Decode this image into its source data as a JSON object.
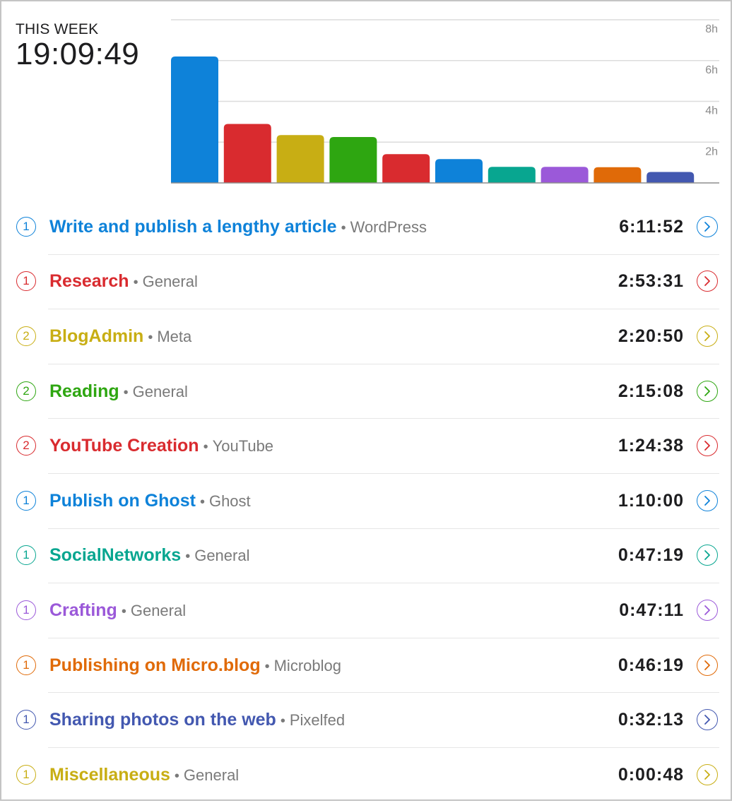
{
  "summary": {
    "label": "THIS WEEK",
    "total": "19:09:49"
  },
  "chart_data": {
    "type": "bar",
    "title": "",
    "xlabel": "",
    "ylabel": "",
    "ylim": [
      0,
      8
    ],
    "yticks": [
      {
        "value": 2,
        "label": "2h"
      },
      {
        "value": 4,
        "label": "4h"
      },
      {
        "value": 6,
        "label": "6h"
      },
      {
        "value": 8,
        "label": "8h"
      }
    ],
    "grid": true,
    "categories": [
      "Write and publish a lengthy article",
      "Research",
      "BlogAdmin",
      "Reading",
      "YouTube Creation",
      "Publish on Ghost",
      "SocialNetworks",
      "Crafting",
      "Publishing on Micro.blog",
      "Sharing photos on the web"
    ],
    "values": [
      6.198,
      2.892,
      2.347,
      2.252,
      1.411,
      1.167,
      0.789,
      0.786,
      0.772,
      0.537
    ],
    "colors": [
      "#0e82d9",
      "#d92b2f",
      "#c8ae14",
      "#2ea611",
      "#d92b2f",
      "#0e82d9",
      "#08a690",
      "#9b59d9",
      "#e06a08",
      "#4358b0"
    ]
  },
  "activities": [
    {
      "count": "1",
      "title": "Write and publish a lengthy article",
      "group": "WordPress",
      "duration": "6:11:52",
      "color": "#0e82d9"
    },
    {
      "count": "1",
      "title": "Research",
      "group": "General",
      "duration": "2:53:31",
      "color": "#d92b2f"
    },
    {
      "count": "2",
      "title": "BlogAdmin",
      "group": "Meta",
      "duration": "2:20:50",
      "color": "#c8ae14"
    },
    {
      "count": "2",
      "title": "Reading",
      "group": "General",
      "duration": "2:15:08",
      "color": "#2ea611"
    },
    {
      "count": "2",
      "title": "YouTube Creation",
      "group": "YouTube",
      "duration": "1:24:38",
      "color": "#d92b2f"
    },
    {
      "count": "1",
      "title": "Publish on Ghost",
      "group": "Ghost",
      "duration": "1:10:00",
      "color": "#0e82d9"
    },
    {
      "count": "1",
      "title": "SocialNetworks",
      "group": "General",
      "duration": "0:47:19",
      "color": "#08a690"
    },
    {
      "count": "1",
      "title": "Crafting",
      "group": "General",
      "duration": "0:47:11",
      "color": "#9b59d9"
    },
    {
      "count": "1",
      "title": "Publishing on Micro.blog",
      "group": "Microblog",
      "duration": "0:46:19",
      "color": "#e06a08"
    },
    {
      "count": "1",
      "title": "Sharing photos on the web",
      "group": "Pixelfed",
      "duration": "0:32:13",
      "color": "#4358b0"
    },
    {
      "count": "1",
      "title": "Miscellaneous",
      "group": "General",
      "duration": "0:00:48",
      "color": "#c8ae14"
    }
  ],
  "separator": "•"
}
